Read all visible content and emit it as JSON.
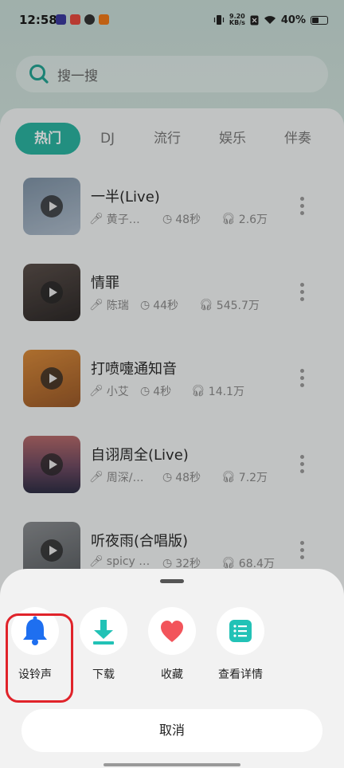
{
  "status_bar": {
    "time": "12:58",
    "net_speed_value": "9.20",
    "net_speed_unit": "KB/s",
    "battery": "40%"
  },
  "search": {
    "placeholder": "搜一搜",
    "icon": "search-icon"
  },
  "tabs": [
    "热门",
    "DJ",
    "流行",
    "娱乐",
    "伴奏"
  ],
  "active_tab": "热门",
  "songs": [
    {
      "title": "一半(Live)",
      "artist": "黄子…",
      "duration": "48秒",
      "plays": "2.6万"
    },
    {
      "title": "情罪",
      "artist": "陈瑞",
      "duration": "44秒",
      "plays": "545.7万"
    },
    {
      "title": "打喷嚏通知音",
      "artist": "小艾",
      "duration": "4秒",
      "plays": "14.1万"
    },
    {
      "title": "自诩周全(Live)",
      "artist": "周深/…",
      "duration": "48秒",
      "plays": "7.2万"
    },
    {
      "title": "听夜雨(合唱版)",
      "artist": "spicy …",
      "duration": "32秒",
      "plays": "68.4万"
    }
  ],
  "sheet": {
    "actions": [
      {
        "label": "设铃声",
        "icon": "bell-icon",
        "color": "#1e6ff0"
      },
      {
        "label": "下载",
        "icon": "download-icon",
        "color": "#22c2b6"
      },
      {
        "label": "收藏",
        "icon": "heart-icon",
        "color": "#f2545b"
      },
      {
        "label": "查看详情",
        "icon": "list-icon",
        "color": "#22c2b6"
      }
    ],
    "cancel": "取消"
  },
  "colors": {
    "accent": "#2bb3a0",
    "highlight": "#e0232a"
  }
}
